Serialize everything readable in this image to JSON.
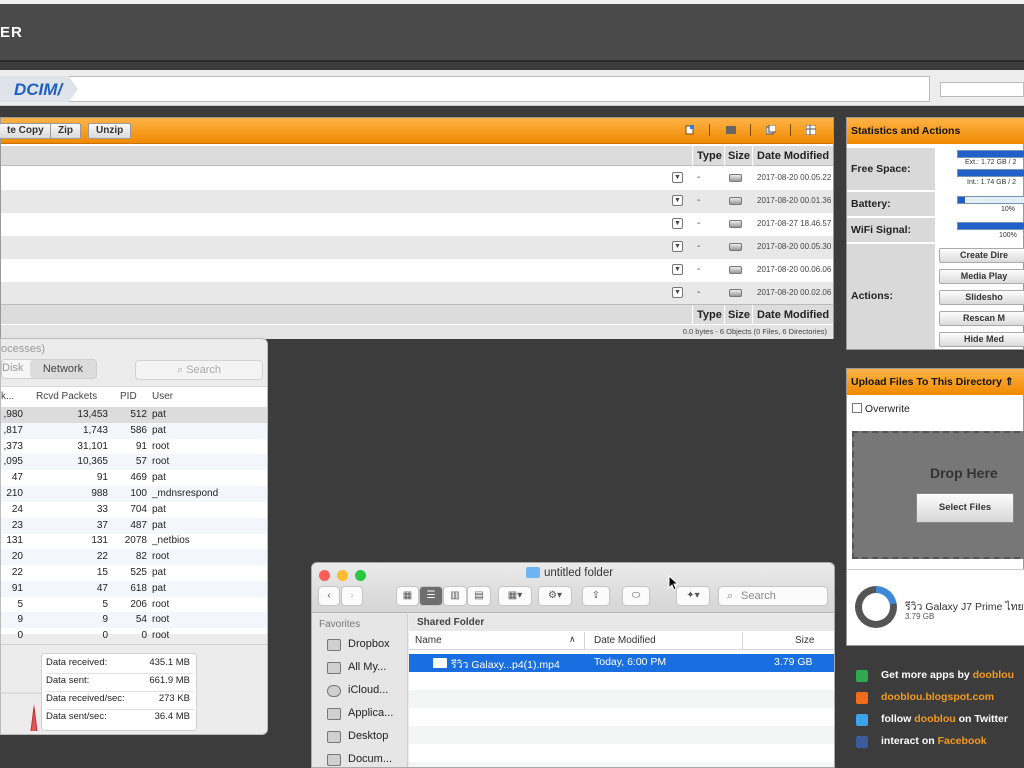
{
  "app": {
    "logo_text": "ER",
    "path": "DCIM/"
  },
  "file_manager": {
    "toolbar": {
      "paste_copy": "te Copy",
      "zip": "Zip",
      "unzip": "Unzip"
    },
    "columns": {
      "type": "Type",
      "size": "Size",
      "date_modified": "Date Modified"
    },
    "rows": [
      {
        "type": "-",
        "date": "2017-08-20 00.05.22"
      },
      {
        "type": "-",
        "date": "2017-08-20 00.01.36"
      },
      {
        "type": "-",
        "date": "2017-08-27 18.46.57"
      },
      {
        "type": "-",
        "date": "2017-08-20 00.05.30"
      },
      {
        "type": "-",
        "date": "2017-08-20 00.06.06"
      },
      {
        "type": "-",
        "date": "2017-08-20 00.02.06"
      }
    ],
    "status": "0.0 bytes - 6 Objects (0 Files, 6 Directories)"
  },
  "stats": {
    "title": "Statistics and Actions",
    "free_space_label": "Free Space:",
    "ext_text": "Ext.: 1.72 GB / 2",
    "int_text": "Int.: 1.74 GB / 2",
    "battery_label": "Battery:",
    "battery_value": "10%",
    "battery_level": 0.1,
    "wifi_label": "WiFi Signal:",
    "wifi_value": "100%",
    "wifi_level": 1.0,
    "actions_label": "Actions:",
    "buttons": [
      "Create Dire",
      "Media Play",
      "Slidesho",
      "Rescan M",
      "Hide Med"
    ]
  },
  "upload": {
    "title": "Upload Files To This Directory",
    "arrow": "⇑",
    "overwrite_label": "Overwrite",
    "drop_here": "Drop Here",
    "select_files": "Select Files",
    "device_name": "รีวิว Galaxy J7 Prime ไทย",
    "device_size": "3.79 GB"
  },
  "links": [
    {
      "prefix": "Get more apps by ",
      "highlight": "dooblou",
      "suffix": "",
      "color": "#2fa84f"
    },
    {
      "prefix": "",
      "highlight": "dooblou.blogspot.com",
      "suffix": "",
      "color": "#f26b1d"
    },
    {
      "prefix": "follow ",
      "highlight": "dooblou",
      "suffix": " on Twitter",
      "color": "#3ba3e8"
    },
    {
      "prefix": "interact on ",
      "highlight": "Facebook",
      "suffix": "",
      "color": "#3b5b9c"
    }
  ],
  "activity_monitor": {
    "title": "ocesses)",
    "tab_disk": "Disk",
    "tab_network": "Network",
    "search_placeholder": "Search",
    "columns": [
      "k...",
      "Rcvd Packets",
      "PID",
      "User"
    ],
    "rows": [
      {
        "sent": ",980",
        "rcvd": "13,453",
        "pid": "512",
        "user": "pat"
      },
      {
        "sent": ",817",
        "rcvd": "1,743",
        "pid": "586",
        "user": "pat"
      },
      {
        "sent": ",373",
        "rcvd": "31,101",
        "pid": "91",
        "user": "root"
      },
      {
        "sent": ",095",
        "rcvd": "10,365",
        "pid": "57",
        "user": "root"
      },
      {
        "sent": "47",
        "rcvd": "91",
        "pid": "469",
        "user": "pat"
      },
      {
        "sent": "210",
        "rcvd": "988",
        "pid": "100",
        "user": "_mdnsrespond"
      },
      {
        "sent": "24",
        "rcvd": "33",
        "pid": "704",
        "user": "pat"
      },
      {
        "sent": "23",
        "rcvd": "37",
        "pid": "487",
        "user": "pat"
      },
      {
        "sent": "131",
        "rcvd": "131",
        "pid": "2078",
        "user": "_netbios"
      },
      {
        "sent": "20",
        "rcvd": "22",
        "pid": "82",
        "user": "root"
      },
      {
        "sent": "22",
        "rcvd": "15",
        "pid": "525",
        "user": "pat"
      },
      {
        "sent": "91",
        "rcvd": "47",
        "pid": "618",
        "user": "pat"
      },
      {
        "sent": "5",
        "rcvd": "5",
        "pid": "206",
        "user": "root"
      },
      {
        "sent": "9",
        "rcvd": "9",
        "pid": "54",
        "user": "root"
      },
      {
        "sent": "0",
        "rcvd": "0",
        "pid": "0",
        "user": "root"
      }
    ],
    "summary": [
      {
        "label": "Data received:",
        "value": "435.1 MB"
      },
      {
        "label": "Data sent:",
        "value": "661.9 MB"
      },
      {
        "label": "Data received/sec:",
        "value": "273 KB"
      },
      {
        "label": "Data sent/sec:",
        "value": "36.4 MB"
      }
    ]
  },
  "finder": {
    "title": "untitled folder",
    "search_placeholder": "Search",
    "favorites_label": "Favorites",
    "sidebar": [
      "Dropbox",
      "All My...",
      "iCloud...",
      "Applica...",
      "Desktop",
      "Docum..."
    ],
    "section": "Shared Folder",
    "columns": {
      "name": "Name",
      "date": "Date Modified",
      "size": "Size"
    },
    "file": {
      "name": "รีวิว Galaxy...p4(1).mp4",
      "date": "Today, 6:00 PM",
      "size": "3.79 GB"
    }
  }
}
